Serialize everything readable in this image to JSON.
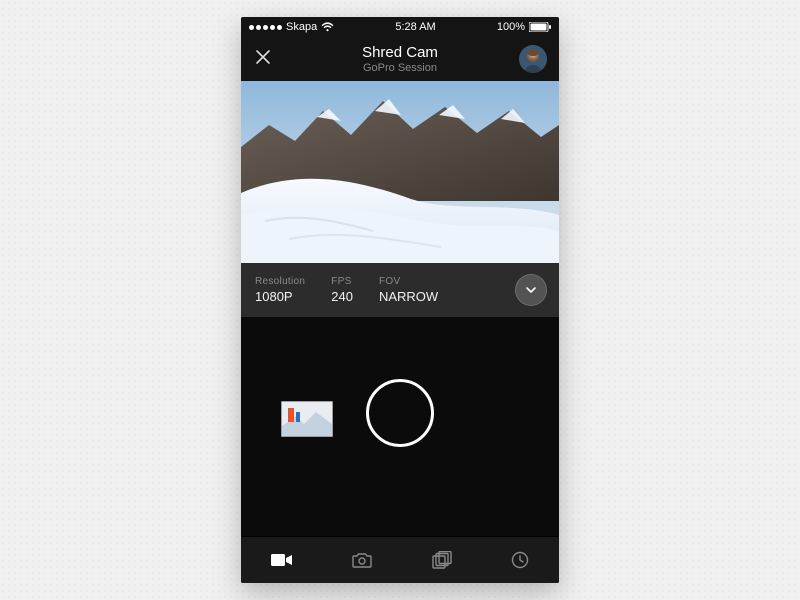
{
  "status": {
    "carrier": "Skapa",
    "time": "5:28 AM",
    "battery": "100%"
  },
  "nav": {
    "title": "Shred Cam",
    "subtitle": "GoPro Session"
  },
  "settings": {
    "resolution_label": "Resolution",
    "resolution_value": "1080P",
    "fps_label": "FPS",
    "fps_value": "240",
    "fov_label": "FOV",
    "fov_value": "NARROW"
  }
}
